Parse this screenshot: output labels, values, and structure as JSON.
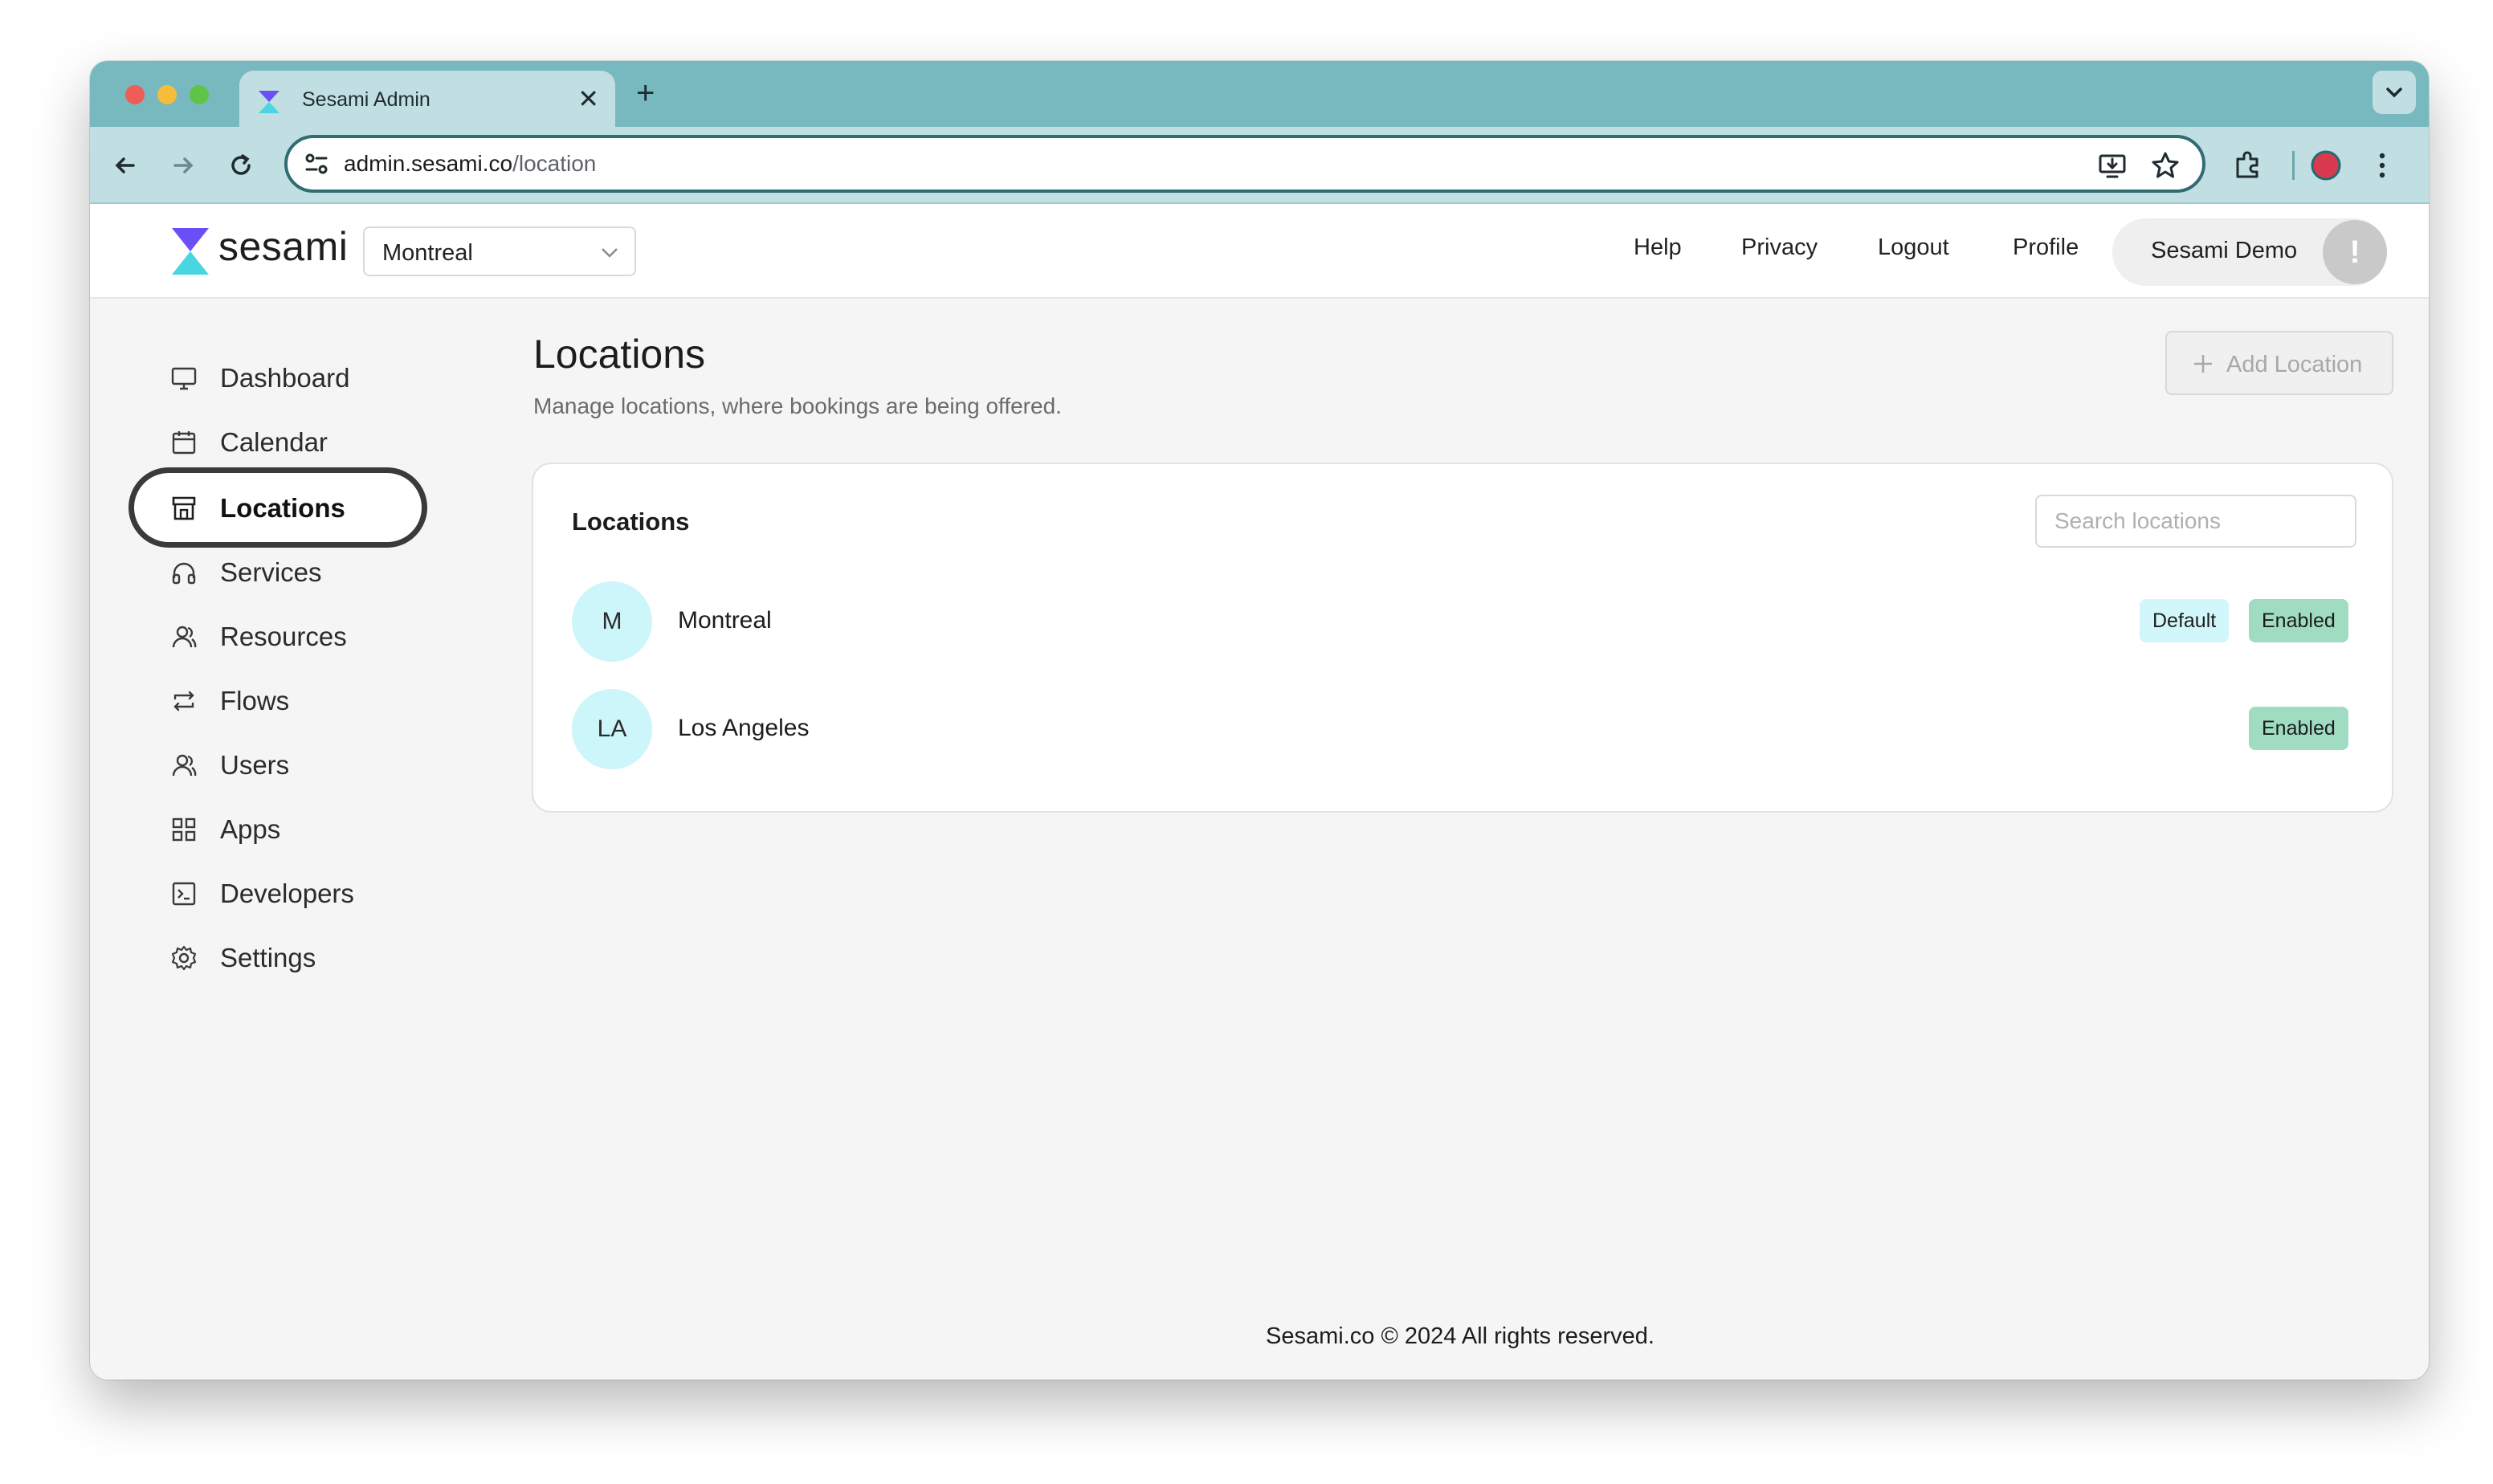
{
  "browser": {
    "tab_title": "Sesami Admin",
    "url_host": "admin.sesami.co",
    "url_path": "/location"
  },
  "header": {
    "logo_text": "sesami",
    "location_selector": "Montreal",
    "links": [
      "Help",
      "Privacy",
      "Logout",
      "Profile"
    ],
    "user_name": "Sesami Demo",
    "user_avatar_glyph": "!"
  },
  "sidebar": {
    "items": [
      {
        "label": "Dashboard",
        "icon": "monitor-icon"
      },
      {
        "label": "Calendar",
        "icon": "calendar-icon"
      },
      {
        "label": "Locations",
        "icon": "store-icon",
        "active": true
      },
      {
        "label": "Services",
        "icon": "headphones-icon"
      },
      {
        "label": "Resources",
        "icon": "person-icon"
      },
      {
        "label": "Flows",
        "icon": "repeat-icon"
      },
      {
        "label": "Users",
        "icon": "person-icon"
      },
      {
        "label": "Apps",
        "icon": "grid-icon"
      },
      {
        "label": "Developers",
        "icon": "terminal-icon"
      },
      {
        "label": "Settings",
        "icon": "gear-icon"
      }
    ]
  },
  "main": {
    "title": "Locations",
    "subtitle": "Manage locations, where bookings are being offered.",
    "add_button": "Add Location",
    "card": {
      "title": "Locations",
      "search_placeholder": "Search locations",
      "rows": [
        {
          "initials": "M",
          "name": "Montreal",
          "badges": [
            "Default",
            "Enabled"
          ]
        },
        {
          "initials": "LA",
          "name": "Los Angeles",
          "badges": [
            "Enabled"
          ]
        }
      ]
    }
  },
  "footer": "Sesami.co © 2024  All rights reserved.",
  "colors": {
    "chrome_tabbar": "#78b9bf",
    "chrome_toolbar": "#c1dfe2",
    "avatar_bg": "#cdf6fa",
    "badge_default": "#d2f7fb",
    "badge_enabled": "#9fdcc2"
  }
}
